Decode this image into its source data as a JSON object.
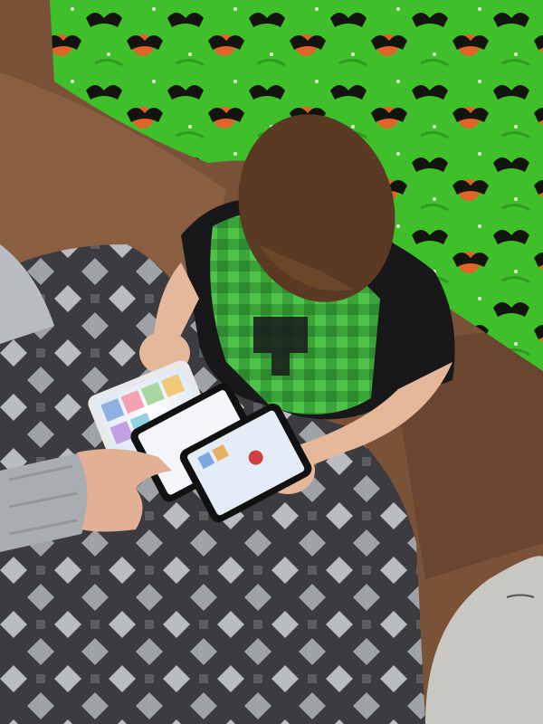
{
  "scene": {
    "colors": {
      "fleece_green": "#3fbf2a",
      "fleece_green_dark": "#2f9a20",
      "bat_black": "#14140f",
      "pumpkin_orange": "#e0642a",
      "sofa_brown": "#7a5237",
      "sofa_brown_dark": "#5a3a26",
      "blanket_dark": "#3c3c40",
      "blanket_light": "#b9bcc0",
      "shirt_black": "#18181b",
      "shirt_green": "#3aa43a",
      "hair_brown": "#5a3a22",
      "skin": "#e6b89a",
      "sleeve_grey": "#a9adb2",
      "screen_glow": "#eef4ff",
      "plush_grey": "#c9c7c2"
    },
    "phones": [
      {
        "name": "phone-left",
        "screen_tint": "#dfe8f5"
      },
      {
        "name": "phone-middle",
        "screen_tint": "#f4f6fb"
      },
      {
        "name": "phone-right",
        "screen_tint": "#e3ecf7"
      }
    ]
  }
}
